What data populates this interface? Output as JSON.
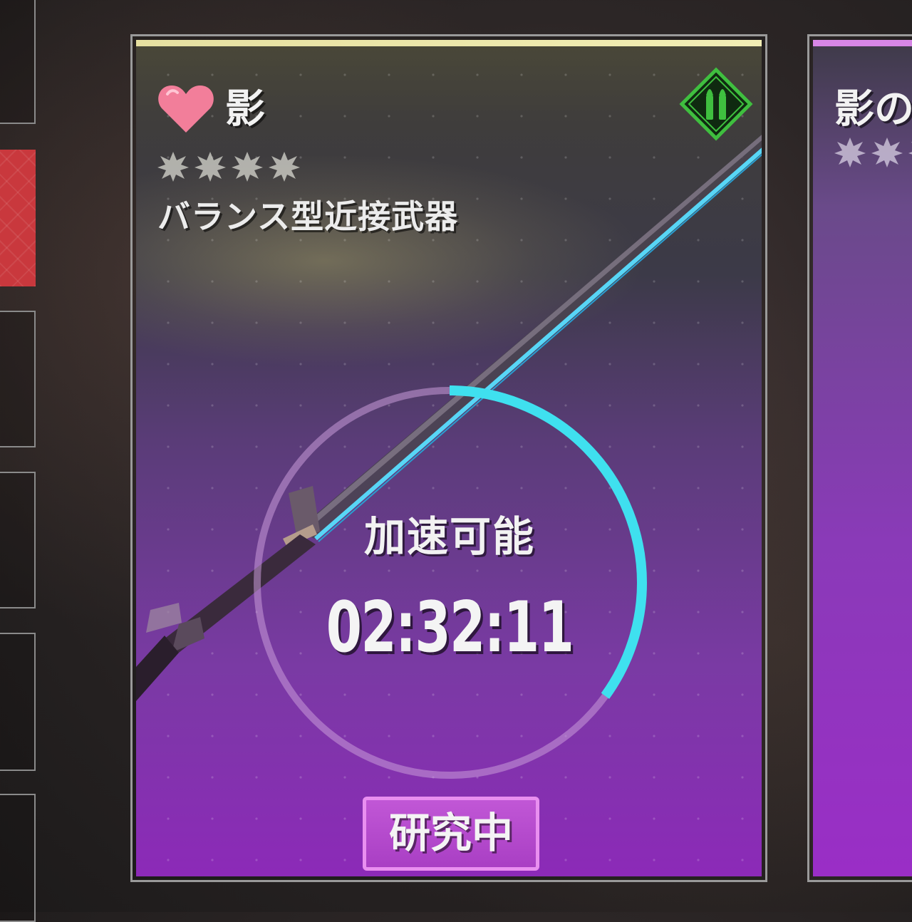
{
  "cards": [
    {
      "name": "影",
      "rarity_stars": 4,
      "type": "バランス型近接武器",
      "favorite": true,
      "ammo_icon": "bullets-icon",
      "progress_label": "加速可能",
      "timer": "02:32:11",
      "progress_fraction": 0.35,
      "status_button": "研究中"
    },
    {
      "name": "影の"
    }
  ],
  "colors": {
    "progress_ring": "#3fe0ef",
    "ring_track": "#c89ad8",
    "favorite_heart": "#f27e9a",
    "ammo_badge": "#3fbf3f",
    "status_button_bg": "#b34acb",
    "card_topbar": "#eae4a4",
    "next_card_topbar": "#d786e6",
    "active_side_tab": "#c9383d"
  }
}
